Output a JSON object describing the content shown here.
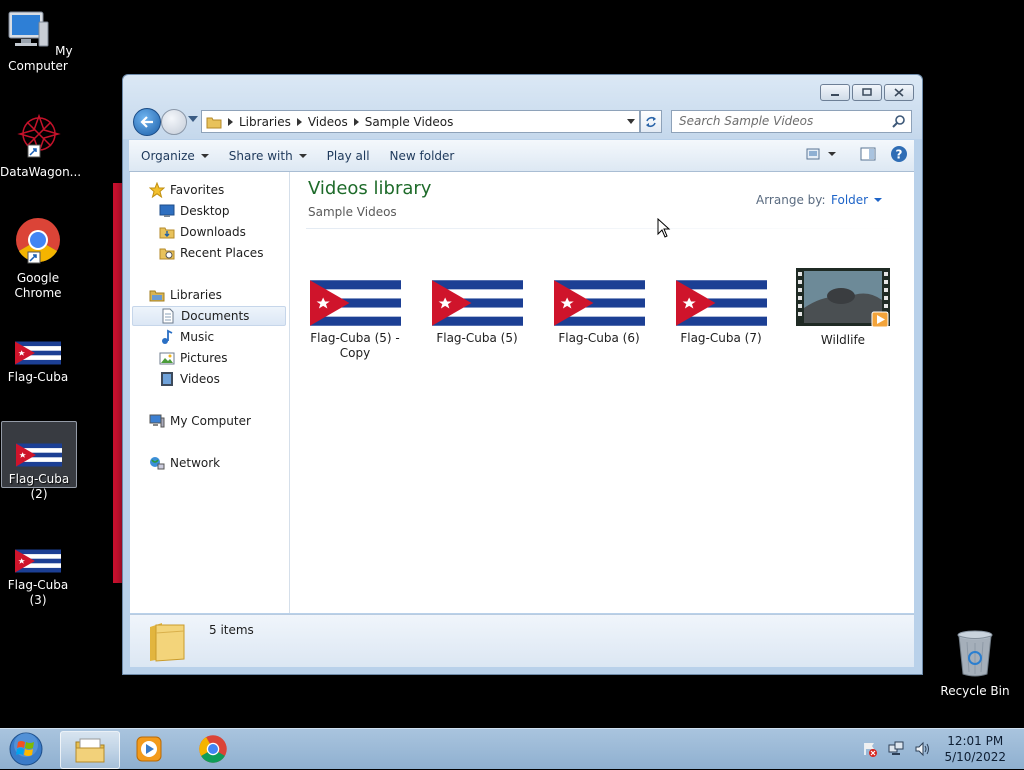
{
  "desktop": {
    "icons": [
      {
        "label": "My Computer"
      },
      {
        "label": "DataWagon..."
      },
      {
        "label": "Google Chrome"
      },
      {
        "label": "Flag-Cuba"
      },
      {
        "label": "Flag-Cuba (2)"
      },
      {
        "label": "Flag-Cuba (3)"
      }
    ],
    "recycle_bin": "Recycle Bin"
  },
  "window": {
    "address": {
      "crumbs": [
        "Libraries",
        "Videos",
        "Sample Videos"
      ]
    },
    "search": {
      "placeholder": "Search Sample Videos"
    },
    "toolbar": {
      "organize": "Organize",
      "share_with": "Share with",
      "play_all": "Play all",
      "new_folder": "New folder"
    },
    "nav": {
      "favorites": "Favorites",
      "desktop": "Desktop",
      "downloads": "Downloads",
      "recent_places": "Recent Places",
      "libraries": "Libraries",
      "documents": "Documents",
      "music": "Music",
      "pictures": "Pictures",
      "videos": "Videos",
      "my_computer": "My Computer",
      "network": "Network"
    },
    "content": {
      "title": "Videos library",
      "subtitle": "Sample Videos",
      "arrange_label": "Arrange by:",
      "arrange_value": "Folder",
      "files": [
        {
          "name": "Flag-Cuba (5) - Copy"
        },
        {
          "name": "Flag-Cuba (5)"
        },
        {
          "name": "Flag-Cuba (6)"
        },
        {
          "name": "Flag-Cuba (7)"
        },
        {
          "name": "Wildlife"
        }
      ]
    },
    "details": {
      "count": "5 items"
    }
  },
  "taskbar": {
    "time": "12:01 PM",
    "date": "5/10/2022"
  },
  "colors": {
    "flag_blue": "#1c3f94",
    "flag_red": "#cf142b",
    "library_title": "#1e6b2a",
    "link_blue": "#1e64c8"
  }
}
